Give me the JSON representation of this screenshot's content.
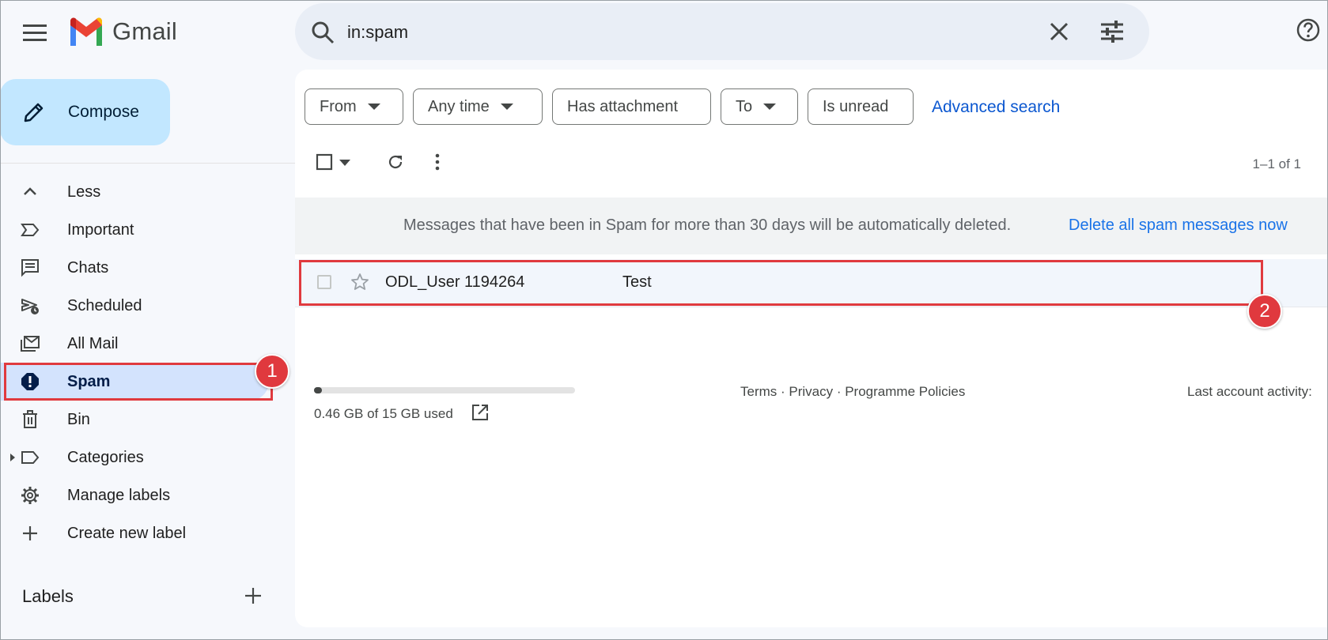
{
  "header": {
    "app_name": "Gmail",
    "search_value": "in:spam",
    "icons": [
      "menu-icon",
      "gmail-logo",
      "search-icon",
      "clear-icon",
      "search-options-icon",
      "help-icon"
    ]
  },
  "sidebar": {
    "compose_label": "Compose",
    "items": [
      {
        "label": "Less",
        "icon": "chevron-up-icon"
      },
      {
        "label": "Important",
        "icon": "important-icon"
      },
      {
        "label": "Chats",
        "icon": "chat-icon"
      },
      {
        "label": "Scheduled",
        "icon": "scheduled-icon"
      },
      {
        "label": "All Mail",
        "icon": "all-mail-icon"
      },
      {
        "label": "Spam",
        "icon": "spam-icon",
        "active": true
      },
      {
        "label": "Bin",
        "icon": "bin-icon"
      },
      {
        "label": "Categories",
        "icon": "label-icon"
      },
      {
        "label": "Manage labels",
        "icon": "gear-icon"
      },
      {
        "label": "Create new label",
        "icon": "plus-icon"
      }
    ],
    "labels_title": "Labels"
  },
  "filters": {
    "chips": [
      "From",
      "Any time",
      "Has attachment",
      "To",
      "Is unread"
    ],
    "advanced_search": "Advanced search"
  },
  "toolbar": {
    "count": "1–1 of 1"
  },
  "notice": {
    "text": "Messages that have been in Spam for more than 30 days will be automatically deleted.",
    "link": "Delete all spam messages now"
  },
  "messages": [
    {
      "sender": "ODL_User 1194264",
      "subject": "Test"
    }
  ],
  "footer": {
    "storage_text": "0.46 GB of 15 GB used",
    "storage_used_fraction": 0.031,
    "links": "Terms · Privacy · Programme Policies",
    "activity": "Last account activity:"
  },
  "annotations": {
    "badge_1": "1",
    "badge_2": "2",
    "color": "#e0393e"
  }
}
